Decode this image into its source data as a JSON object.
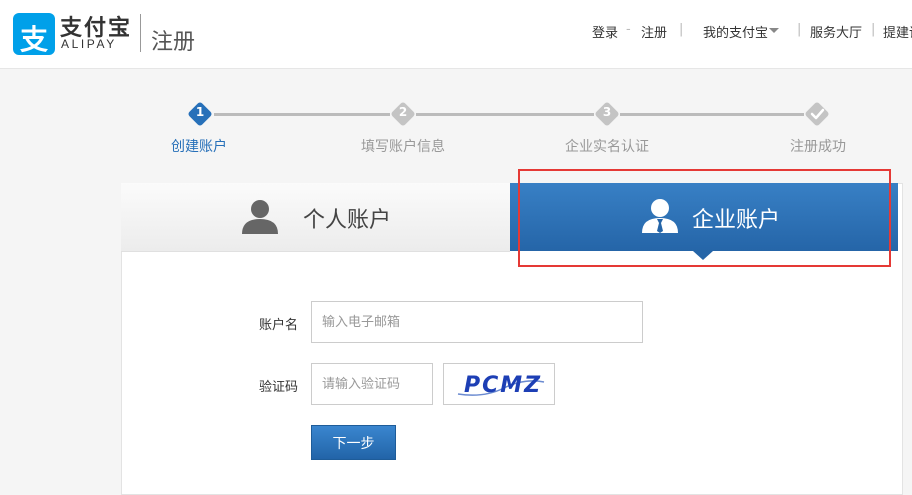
{
  "header": {
    "logo_cn": "支付宝",
    "logo_en": "ALIPAY",
    "logo_glyph": "支",
    "page_name": "注册",
    "nav": {
      "login": "登录",
      "dash": "-",
      "register": "注册",
      "sep": "|",
      "my_alipay": "我的支付宝",
      "service_hall": "服务大厅",
      "suggest": "提建议"
    }
  },
  "steps": [
    {
      "num": "1",
      "label": "创建账户",
      "state": "active"
    },
    {
      "num": "2",
      "label": "填写账户信息",
      "state": "pending"
    },
    {
      "num": "3",
      "label": "企业实名认证",
      "state": "pending"
    },
    {
      "num": "check-icon",
      "label": "注册成功",
      "state": "pending"
    }
  ],
  "tabs": {
    "personal": "个人账户",
    "enterprise": "企业账户",
    "selected": "enterprise"
  },
  "form": {
    "account_label": "账户名",
    "account_placeholder": "输入电子邮箱",
    "account_value": "",
    "captcha_label": "验证码",
    "captcha_placeholder": "请输入验证码",
    "captcha_value": "",
    "captcha_text": "PCMZ",
    "next_button": "下一步"
  },
  "colors": {
    "brand": "#00a0e9",
    "accent": "#2770b9",
    "highlight": "#e53935"
  }
}
